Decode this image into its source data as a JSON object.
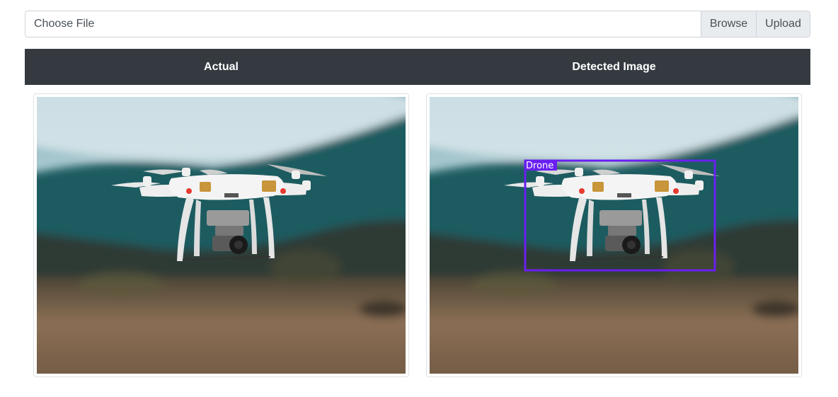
{
  "file_input": {
    "label": "Choose File",
    "browse_label": "Browse",
    "upload_label": "Upload"
  },
  "table_header": {
    "actual": "Actual",
    "detected": "Detected Image"
  },
  "detection": {
    "label": "Drone",
    "box_color": "#6a1ff0"
  },
  "colors": {
    "header_bg": "#343a40",
    "sky": "#9fc2cc",
    "mountain": "#1f5a5e",
    "ground": "#8a6a52"
  }
}
